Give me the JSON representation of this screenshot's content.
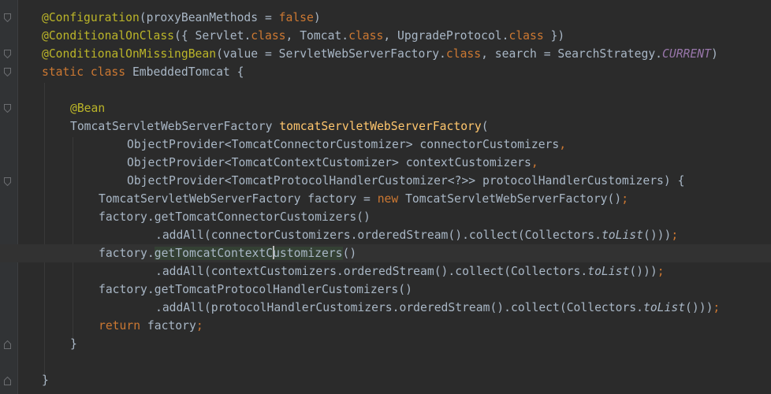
{
  "editor": {
    "language": "Java",
    "theme_colors": {
      "background": "#2b2b2b",
      "annotation": "#bbb529",
      "keyword": "#cc7832",
      "method_declaration": "#ffc66d",
      "static_field": "#9876aa",
      "default_text": "#a9b7c6",
      "current_line": "#323232",
      "identifier_highlight": "#344134"
    },
    "caret": {
      "line": 14,
      "column": 42
    },
    "highlighted_identifier": "getTomcatContextCustomizers",
    "lines": {
      "l1": {
        "a": "@Configuration",
        "b": "(proxyBeanMethods = ",
        "c": "false",
        "d": ")"
      },
      "l2": {
        "a": "@ConditionalOnClass",
        "b": "({ Servlet.",
        "c": "class",
        "d": ", Tomcat.",
        "e": "class",
        "f": ", UpgradeProtocol.",
        "g": "class",
        "h": " })"
      },
      "l3": {
        "a": "@ConditionalOnMissingBean",
        "b": "(value = ServletWebServerFactory.",
        "c": "class",
        "d": ", search = SearchStrategy.",
        "e": "CURRENT",
        "f": ")"
      },
      "l4": {
        "a": "static ",
        "b": "class ",
        "c": "EmbeddedTomcat {"
      },
      "l6": {
        "a": "@Bean"
      },
      "l7": {
        "a": "TomcatServletWebServerFactory ",
        "b": "tomcatServletWebServerFactory",
        "c": "("
      },
      "l8": {
        "a": "ObjectProvider<TomcatConnectorCustomizer> connectorCustomizers",
        "b": ","
      },
      "l9": {
        "a": "ObjectProvider<TomcatContextCustomizer> contextCustomizers",
        "b": ","
      },
      "l10": {
        "a": "ObjectProvider<TomcatProtocolHandlerCustomizer<?>> protocolHandlerCustomizers) {"
      },
      "l11": {
        "a": "TomcatServletWebServerFactory factory = ",
        "b": "new ",
        "c": "TomcatServletWebServerFactory()",
        "d": ";"
      },
      "l12": {
        "a": "factory.getTomcatConnectorCustomizers()"
      },
      "l13": {
        "a": ".addAll(connectorCustomizers.orderedStream().collect(Collectors.",
        "b": "toList",
        "c": "()))",
        "d": ";"
      },
      "l14": {
        "a": "factory.",
        "b": "getTomcatContextC",
        "c": "ustomizers",
        "d": "()"
      },
      "l15": {
        "a": ".addAll(contextCustomizers.orderedStream().collect(Collectors.",
        "b": "toList",
        "c": "()))",
        "d": ";"
      },
      "l16": {
        "a": "factory.getTomcatProtocolHandlerCustomizers()"
      },
      "l17": {
        "a": ".addAll(protocolHandlerCustomizers.orderedStream().collect(Collectors.",
        "b": "toList",
        "c": "()))",
        "d": ";"
      },
      "l18": {
        "a": "return ",
        "b": "factory",
        "c": ";"
      },
      "l19": {
        "a": "}"
      },
      "l21": {
        "a": "}"
      }
    }
  }
}
